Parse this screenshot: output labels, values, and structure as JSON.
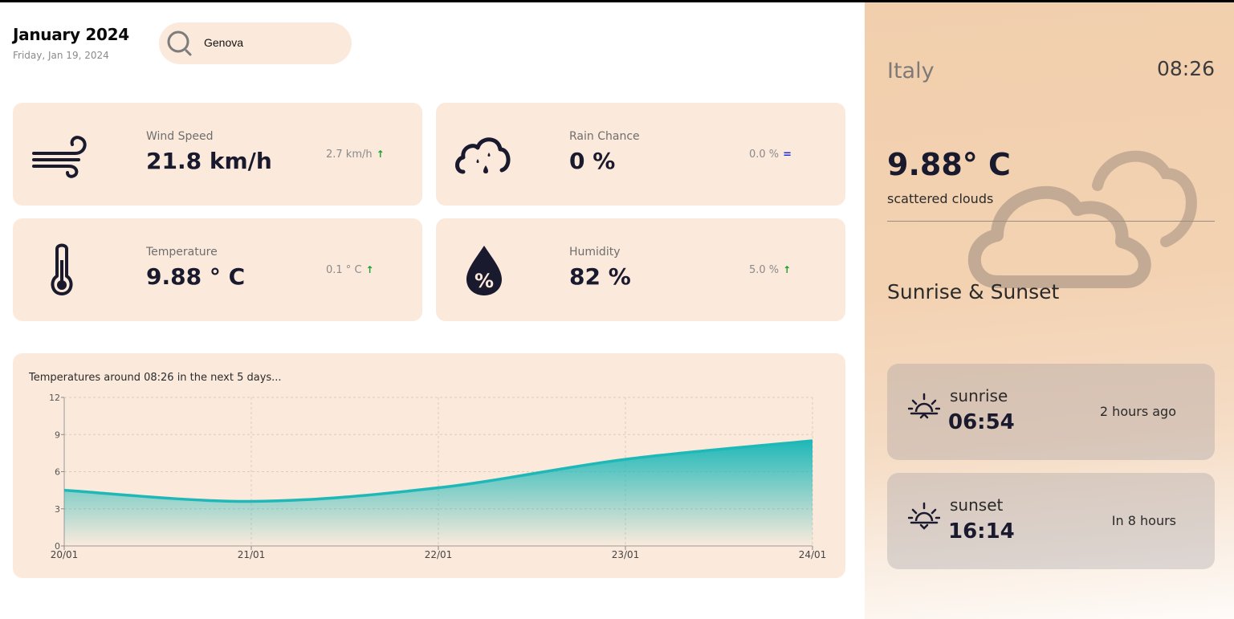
{
  "header": {
    "month": "January 2024",
    "date": "Friday, Jan 19, 2024",
    "search": {
      "value": "Genova",
      "icon": "search-icon"
    }
  },
  "cards": {
    "wind": {
      "label": "Wind Speed",
      "value": "21.8 km/h",
      "delta": "2.7 km/h",
      "trend": "↑",
      "icon": "wind-icon"
    },
    "rain": {
      "label": "Rain Chance",
      "value": "0 %",
      "delta": "0.0 %",
      "trend": "=",
      "icon": "rain-cloud-icon"
    },
    "temp": {
      "label": "Temperature",
      "value": "9.88 ° C",
      "delta": "0.1 ° C",
      "trend": "↑",
      "icon": "thermometer-icon"
    },
    "humidity": {
      "label": "Humidity",
      "value": "82 %",
      "delta": "5.0 %",
      "trend": "↑",
      "icon": "humidity-drop-icon"
    }
  },
  "chart_title": "Temperatures around 08:26 in the next 5 days...",
  "chart_data": {
    "type": "area",
    "title": "Temperatures around 08:26 in the next 5 days...",
    "categories": [
      "20/01",
      "21/01",
      "22/01",
      "23/01",
      "24/01"
    ],
    "values": [
      4.5,
      3.6,
      4.7,
      7.0,
      8.5
    ],
    "ylim": [
      0,
      12
    ],
    "yticks": [
      "0",
      "3",
      "6",
      "9",
      "12"
    ],
    "grid": true,
    "line_color": "#1fb8b8"
  },
  "panel": {
    "country": "Italy",
    "time": "08:26",
    "temperature": "9.88° C",
    "description": "scattered clouds",
    "weather_icon": "cloud-icon",
    "sun_title": "Sunrise & Sunset",
    "sunrise": {
      "label": "sunrise",
      "time": "06:54",
      "relative": "2 hours ago",
      "icon": "sunrise-icon"
    },
    "sunset": {
      "label": "sunset",
      "time": "16:14",
      "relative": "In 8 hours",
      "icon": "sunset-icon"
    }
  },
  "colors": {
    "card_bg": "#fbeadc",
    "accent": "#1fb8b8",
    "trend_up": "#1aa02c",
    "trend_equal": "#1b2fe0"
  }
}
